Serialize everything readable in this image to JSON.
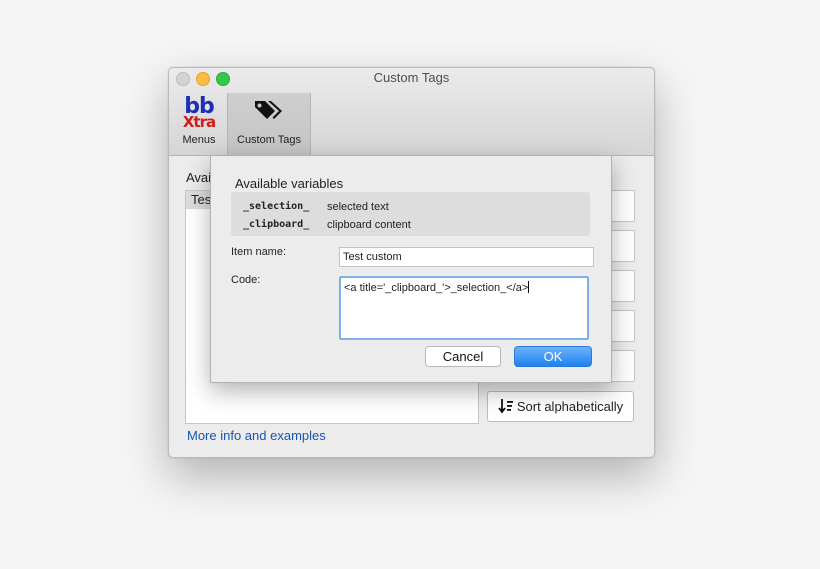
{
  "window": {
    "title": "Custom Tags"
  },
  "toolbar": {
    "items": [
      {
        "label": "Menus",
        "icon": "bbxtra-logo-icon",
        "logo_top": "bb",
        "logo_bottom": "Xtra"
      },
      {
        "label": "Custom Tags",
        "icon": "tags-icon",
        "selected": true
      }
    ]
  },
  "main": {
    "list_label": "Avail",
    "list_items": [
      "Test"
    ],
    "sort_button": "Sort alphabetically",
    "more_link": "More info and examples"
  },
  "dialog": {
    "heading": "Available variables",
    "variables": [
      {
        "name": "_selection_",
        "description": "selected text"
      },
      {
        "name": "_clipboard_",
        "description": "clipboard content"
      }
    ],
    "item_name_label": "Item name:",
    "item_name_value": "Test custom",
    "code_label": "Code:",
    "code_value": "<a title='_clipboard_'>_selection_</a>",
    "cancel_label": "Cancel",
    "ok_label": "OK"
  },
  "colors": {
    "accent": "#1f81f0",
    "link": "#1a54b4",
    "focus_ring": "#7fb0ec"
  }
}
